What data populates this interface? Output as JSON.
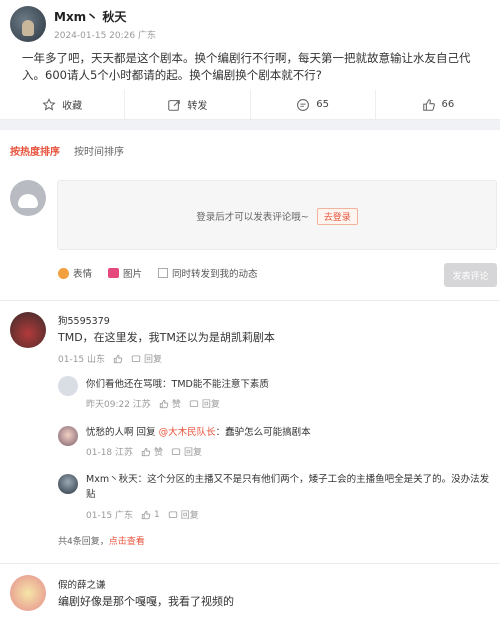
{
  "post": {
    "username": "Mxm丶 秋天",
    "meta": "2024-01-15 20:26  广东",
    "text": "一年多了吧，天天都是这个剧本。换个编剧行不行啊，每天第一把就故意输让水友自己代入。600请人5个小时都请的起。换个编剧换个剧本就不行?"
  },
  "actions": {
    "favorite": "收藏",
    "share": "转发",
    "comments": "65",
    "likes": "66"
  },
  "sort": {
    "hot": "按热度排序",
    "time": "按时间排序"
  },
  "composer": {
    "prompt": "登录后才可以发表评论哦~",
    "login": "去登录",
    "emoji": "表情",
    "image": "图片",
    "repost": "同时转发到我的动态",
    "submit": "发表评论"
  },
  "comments": [
    {
      "name": "狗5595379",
      "text": "TMD，在这里发，我TM还以为是胡凯莉剧本",
      "meta": "01-15  山东",
      "reply": "回复"
    },
    {
      "name": "假的薛之谦",
      "text": "编剧好像是那个嘎嘎，我看了视频的"
    }
  ],
  "replies": [
    {
      "author": "你们看他还在骂哦",
      "text": "：TMD能不能注意下素质",
      "meta": "昨天09:22  江苏",
      "likes": "赞",
      "reply": "回复"
    },
    {
      "author": "忧愁的人啊",
      "prefix": " 回复 ",
      "mention": "@大木民队长",
      "text": "：蠢驴怎么可能搞剧本",
      "meta": "01-18  江苏",
      "likes": "赞",
      "reply": "回复"
    },
    {
      "author": "Mxm丶秋天",
      "text": "：这个分区的主播又不是只有他们两个，矮子工会的主播鱼吧全是关了的。没办法发贴",
      "meta": "01-15  广东",
      "likes": "1",
      "reply": "回复"
    }
  ],
  "more_replies": {
    "count": "共4条回复，",
    "link": "点击查看"
  }
}
